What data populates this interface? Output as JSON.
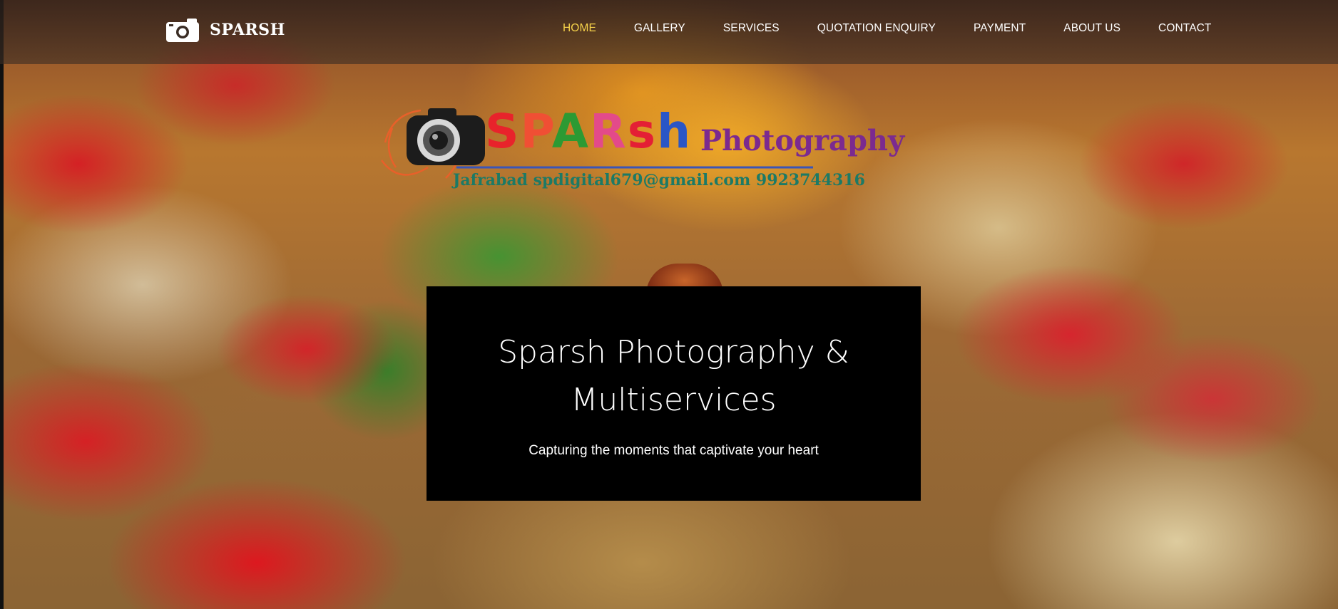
{
  "brand": {
    "name": "SPARSH",
    "icon": "camera-icon"
  },
  "nav": {
    "items": [
      {
        "label": "HOME",
        "active": true
      },
      {
        "label": "GALLERY",
        "active": false
      },
      {
        "label": "SERVICES",
        "active": false
      },
      {
        "label": "QUOTATION ENQUIRY",
        "active": false
      },
      {
        "label": "PAYMENT",
        "active": false
      },
      {
        "label": "ABOUT US",
        "active": false
      },
      {
        "label": "CONTACT",
        "active": false
      }
    ]
  },
  "logo": {
    "word": [
      "S",
      "P",
      "A",
      "R",
      "s",
      "h"
    ],
    "subtitle": "Photography",
    "contact": "Jafrabad spdigital679@gmail.com 9923744316"
  },
  "hero": {
    "title_line1": "Sparsh Photography &",
    "title_line2": "Multiservices",
    "tagline": "Capturing the moments that captivate your heart"
  },
  "colors": {
    "nav_active": "#f6d24a",
    "nav_text": "#ffffff",
    "hero_box": "#000000"
  }
}
